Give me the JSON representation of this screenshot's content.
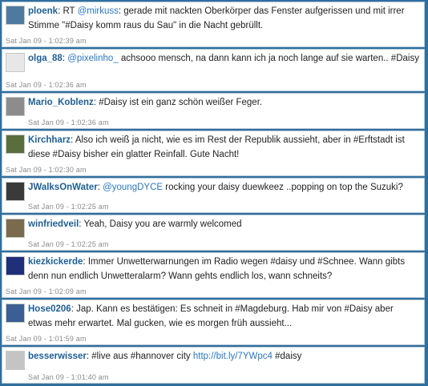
{
  "tweets": [
    {
      "user": "ploenk",
      "pre": "RT ",
      "mention": "@mirkuss",
      "post": ": gerade mit nackten Oberkörper das Fenster aufgerissen und mit irrer Stimme \"#Daisy komm raus du Sau\" in die Nacht gebrüllt.",
      "time": "Sat Jan 09 - 1:02:39 am",
      "avatar_color": "#4f7aa0"
    },
    {
      "user": "olga_88",
      "pre": "",
      "mention": "@pixelinho_",
      "post": " achsooo mensch, na dann kann ich ja noch lange auf sie warten.. #Daisy",
      "time": "Sat Jan 09 - 1:02:36 am",
      "avatar_color": "#e7e7e7"
    },
    {
      "user": "Mario_Koblenz",
      "pre": "",
      "mention": "",
      "post": "#Daisy ist ein ganz schön weißer Feger.",
      "time": "Sat Jan 09 - 1:02:36 am",
      "avatar_color": "#8c8c8c"
    },
    {
      "user": "Kirchharz",
      "pre": "",
      "mention": "",
      "post": "Also ich weiß ja nicht, wie es im Rest der Republik aussieht, aber in #Erftstadt ist diese #Daisy bisher ein glatter Reinfall. Gute Nacht!",
      "time": "Sat Jan 09 - 1:02:30 am",
      "avatar_color": "#5a6e3c"
    },
    {
      "user": "JWalksOnWater",
      "pre": "",
      "mention": "@youngDYCE",
      "post": " rocking your daisy duewkeez ..popping on top the Suzuki?",
      "time": "Sat Jan 09 - 1:02:25 am",
      "avatar_color": "#3a3a3a"
    },
    {
      "user": "winfriedveil",
      "pre": "",
      "mention": "",
      "post": "Yeah, Daisy you are warmly welcomed",
      "time": "Sat Jan 09 - 1:02:25 am",
      "avatar_color": "#7a6a4e"
    },
    {
      "user": "kiezkickerde",
      "pre": "",
      "mention": "",
      "post": "Immer Unwetterwarnungen im Radio wegen #daisy und #Schnee. Wann gibts denn nun endlich Unwetteralarm? Wann gehts endlich los, wann schneits?",
      "time": "Sat Jan 09 - 1:02:09 am",
      "avatar_color": "#1f2f7a"
    },
    {
      "user": "Hose0206",
      "pre": "",
      "mention": "",
      "post": "Jap. Kann es bestätigen: Es schneit in #Magdeburg. Hab mir von #Daisy aber etwas mehr erwartet. Mal gucken, wie es morgen früh aussieht...",
      "time": "Sat Jan 09 - 1:01:59 am",
      "avatar_color": "#3b5f94"
    },
    {
      "user": "besserwisser",
      "pre": "",
      "mention": "",
      "post": "#live aus #hannover city ",
      "link": "http://bit.ly/7YWpc4",
      "post2": " #daisy",
      "time": "Sat Jan 09 - 1:01:40 am",
      "avatar_color": "#c4c4c4"
    }
  ]
}
